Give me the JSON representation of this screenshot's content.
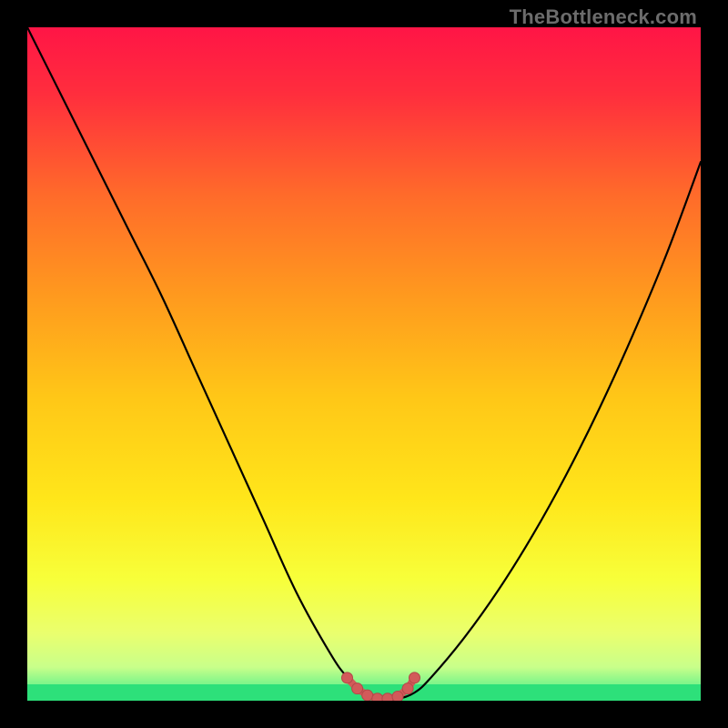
{
  "watermark": "TheBottleneck.com",
  "colors": {
    "frame": "#000000",
    "curve": "#000000",
    "marker_fill": "#d25a5a",
    "marker_stroke": "#b24848",
    "bottom_green": "#2de07a"
  },
  "gradient_stops": [
    {
      "offset": 0.0,
      "color": "#ff1546"
    },
    {
      "offset": 0.1,
      "color": "#ff2e3d"
    },
    {
      "offset": 0.25,
      "color": "#ff6b2a"
    },
    {
      "offset": 0.4,
      "color": "#ff9a1e"
    },
    {
      "offset": 0.55,
      "color": "#ffc717"
    },
    {
      "offset": 0.7,
      "color": "#ffe61a"
    },
    {
      "offset": 0.82,
      "color": "#f7ff3a"
    },
    {
      "offset": 0.9,
      "color": "#eaff6e"
    },
    {
      "offset": 0.95,
      "color": "#c9ff8a"
    },
    {
      "offset": 0.975,
      "color": "#7ef58a"
    },
    {
      "offset": 1.0,
      "color": "#2de07a"
    }
  ],
  "chart_data": {
    "type": "line",
    "title": "",
    "xlabel": "",
    "ylabel": "",
    "xlim": [
      0,
      1
    ],
    "ylim": [
      0,
      1
    ],
    "series": [
      {
        "name": "curve",
        "x": [
          0.0,
          0.05,
          0.1,
          0.15,
          0.2,
          0.25,
          0.3,
          0.35,
          0.4,
          0.45,
          0.475,
          0.5,
          0.525,
          0.55,
          0.575,
          0.6,
          0.65,
          0.7,
          0.75,
          0.8,
          0.85,
          0.9,
          0.95,
          1.0
        ],
        "y": [
          1.0,
          0.9,
          0.8,
          0.7,
          0.6,
          0.49,
          0.38,
          0.27,
          0.16,
          0.07,
          0.035,
          0.012,
          0.003,
          0.003,
          0.012,
          0.035,
          0.095,
          0.165,
          0.245,
          0.335,
          0.435,
          0.545,
          0.665,
          0.8
        ]
      }
    ],
    "markers": {
      "name": "highlight",
      "x": [
        0.475,
        0.49,
        0.505,
        0.52,
        0.535,
        0.55,
        0.565,
        0.575
      ],
      "y": [
        0.034,
        0.018,
        0.008,
        0.003,
        0.003,
        0.006,
        0.018,
        0.034
      ]
    }
  }
}
